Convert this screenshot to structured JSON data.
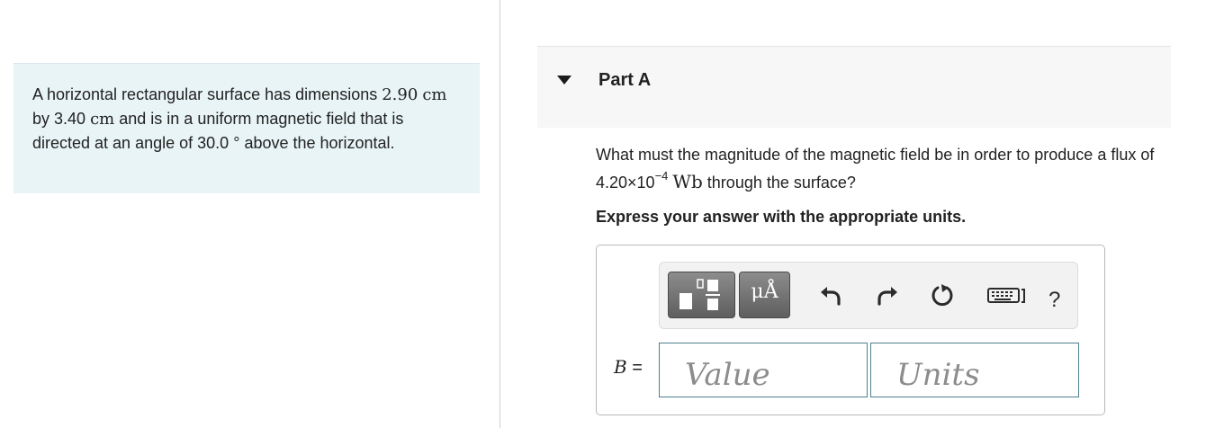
{
  "problem": {
    "t1": "A horizontal rectangular surface has dimensions",
    "d1": "2.90",
    "u1": "cm",
    "t2": "by",
    "d2": "3.40",
    "u2": "cm",
    "t3": "and is in a uniform magnetic field that is directed at an angle of",
    "angle": "30.0",
    "deg": "°",
    "t4": "above the horizontal."
  },
  "part": {
    "title": "Part A"
  },
  "question": {
    "q1": "What must the magnitude of the magnetic field be in order to produce a flux of",
    "mantissa": "4.20×10",
    "exponent": "−4",
    "unit": "Wb",
    "q2": "through the surface?",
    "instruction": "Express your answer with the appropriate units."
  },
  "toolbar": {
    "units_label": "μÅ",
    "help_label": "?",
    "icons": [
      "templates-icon",
      "units-icon",
      "undo-icon",
      "redo-icon",
      "reset-icon",
      "keyboard-icon",
      "help-icon"
    ]
  },
  "answer": {
    "variable": "B",
    "equals": "=",
    "value_placeholder": "Value",
    "units_placeholder": "Units"
  },
  "colors": {
    "problem_bg": "#e8f4f6",
    "field_border": "#4f7f90",
    "toolbar_button": "#6f6f6f"
  }
}
